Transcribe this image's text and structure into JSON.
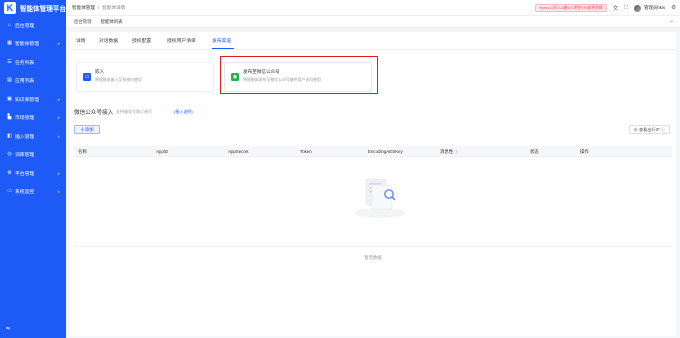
{
  "app": {
    "logo_letter": "K",
    "name": "智能体管理平台"
  },
  "sidebar": {
    "items": [
      {
        "label": "后台管理",
        "icon": "home-icon",
        "has_children": false
      },
      {
        "label": "智能体管理",
        "icon": "grid-icon",
        "has_children": true
      },
      {
        "label": "任务列表",
        "icon": "list-icon",
        "has_children": false
      },
      {
        "label": "应用列表",
        "icon": "apps-icon",
        "has_children": false
      },
      {
        "label": "知识库管理",
        "icon": "book-icon",
        "has_children": true
      },
      {
        "label": "市场管理",
        "icon": "shop-icon",
        "has_children": true
      },
      {
        "label": "插入管理",
        "icon": "plugin-icon",
        "has_children": true
      },
      {
        "label": "词库管理",
        "icon": "lexicon-icon",
        "has_children": false
      },
      {
        "label": "平台管理",
        "icon": "gear-icon",
        "has_children": true
      },
      {
        "label": "系统监控",
        "icon": "monitor-icon",
        "has_children": true
      }
    ],
    "collapse_glyph": "⇆"
  },
  "topbar": {
    "breadcrumb": [
      "智能体管理",
      "智能体详情"
    ],
    "key_badge": "Kymo11开OJ4匿571密钥计4前将到期",
    "username": "管理员hkis",
    "icons": [
      "translate-icon",
      "fullscreen-icon",
      "settings-icon"
    ]
  },
  "pagetabs": {
    "items": [
      "后台管理",
      "智能体列表"
    ],
    "more_glyph": "⌄"
  },
  "subtabs": {
    "items": [
      "详情",
      "对话数据",
      "授权配置",
      "授权用户清单",
      "发布渠道"
    ],
    "active_index": 4
  },
  "options": [
    {
      "title": "嵌入",
      "desc": "将智能体嵌入至系统内使用",
      "icon": "embed-icon",
      "icon_glyph": "▭"
    },
    {
      "title": "发布至微信公众号",
      "desc": "将智能体发布至微信公众号端供用户访问使用",
      "icon": "wechat-icon",
      "icon_glyph": "◉",
      "highlighted": true
    }
  ],
  "section": {
    "title": "微信公众号接入",
    "hint": "支持服务号和订阅号",
    "link": "接入说明"
  },
  "buttons": {
    "add": "十添加",
    "ip": "查看出行IP"
  },
  "table": {
    "columns": [
      "名称",
      "AppID",
      "AppSecret",
      "Token",
      "EncodingAESKey",
      "消息性",
      "状态",
      "操作"
    ],
    "empty_text": "暂无数据"
  },
  "colors": {
    "primary": "#1e5bf6",
    "highlight_border": "#e02020",
    "wechat_green": "#22b14c",
    "badge_text": "#e5484d"
  }
}
